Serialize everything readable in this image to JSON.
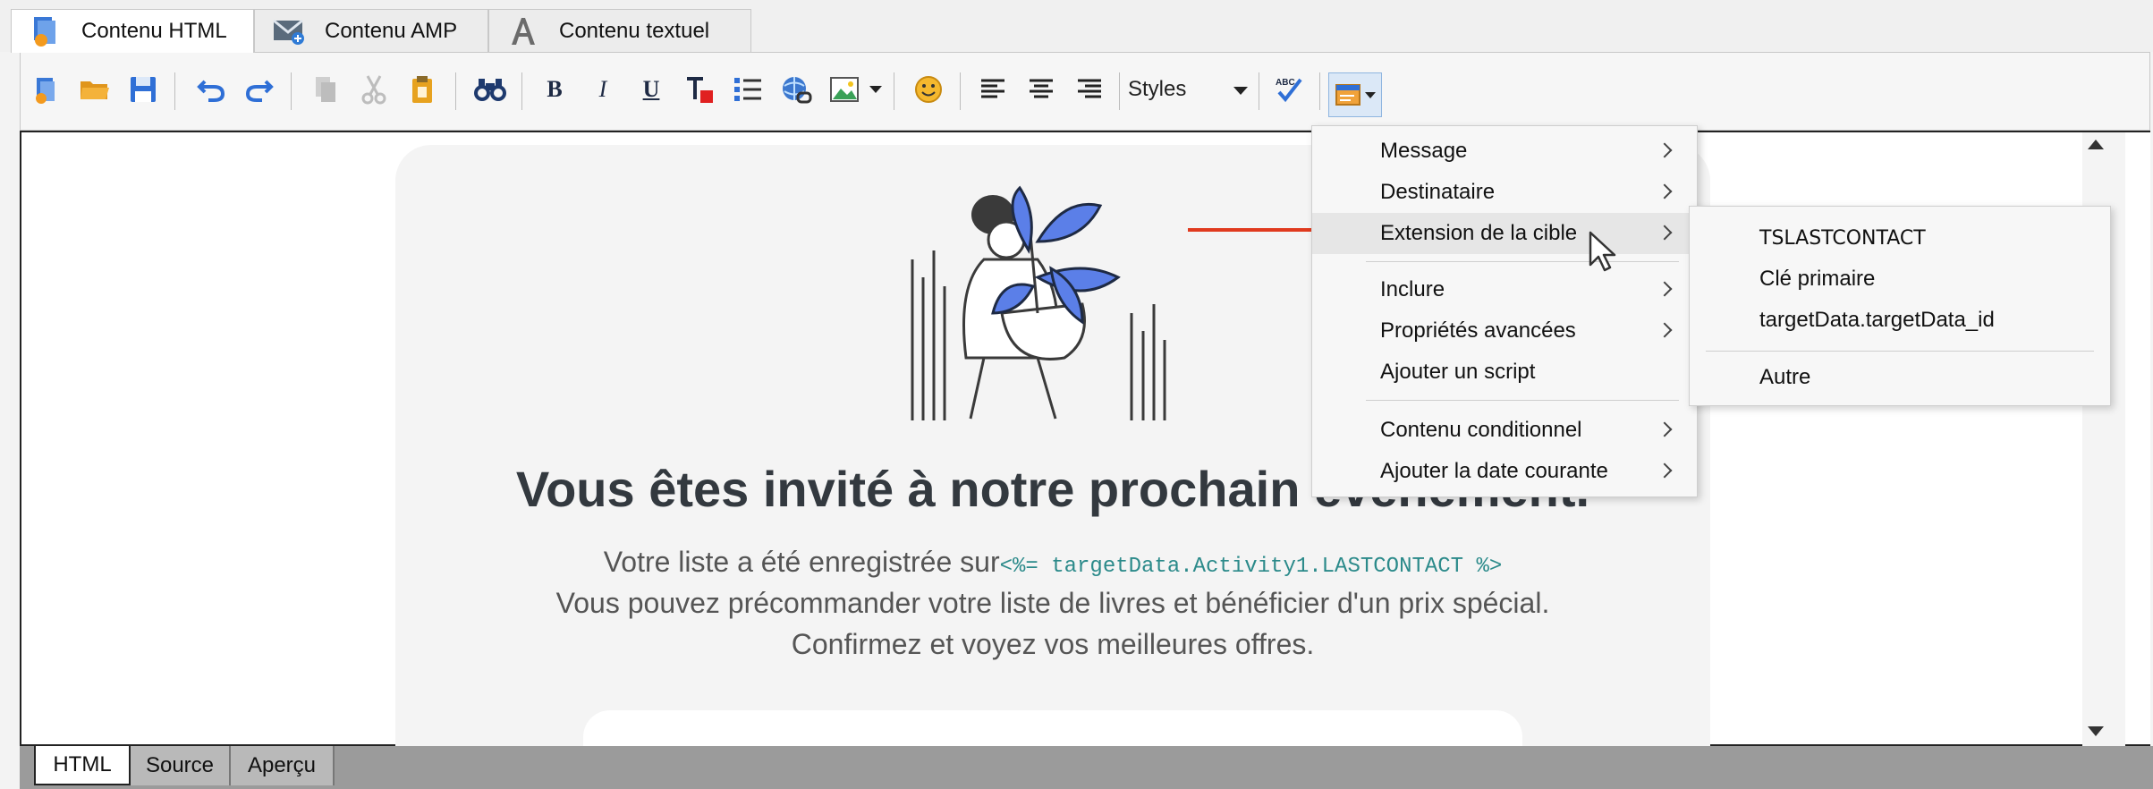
{
  "tabs": [
    {
      "label": "Contenu HTML",
      "icon": "html-content-icon",
      "active": true
    },
    {
      "label": "Contenu AMP",
      "icon": "amp-email-icon",
      "active": false
    },
    {
      "label": "Contenu textuel",
      "icon": "text-content-icon",
      "active": false
    }
  ],
  "toolbar": {
    "bold": "B",
    "italic": "I",
    "underline": "U",
    "styles_label": "Styles",
    "icons": [
      "new-icon",
      "open-folder-icon",
      "save-icon",
      "undo-icon",
      "redo-icon",
      "copy-icon",
      "cut-icon",
      "paste-icon",
      "find-icon",
      "bold-icon",
      "italic-icon",
      "underline-icon",
      "text-color-icon",
      "list-icon",
      "link-icon",
      "image-icon",
      "emoticon-icon",
      "align-left-icon",
      "align-center-icon",
      "align-right-icon",
      "spellcheck-icon",
      "personalization-icon"
    ]
  },
  "email": {
    "heading": "Vous êtes invité à notre prochain événement.",
    "line1_prefix": "Votre liste a été enregistrée sur",
    "line1_code": "<%= targetData.Activity1.LASTCONTACT %>",
    "line2": "Vous pouvez précommander votre liste de livres et bénéficier d'un prix spécial.",
    "line3": "Confirmez et voyez vos meilleures offres."
  },
  "context_menu": {
    "items": [
      {
        "label": "Message",
        "submenu": true
      },
      {
        "label": "Destinataire",
        "submenu": true
      },
      {
        "label": "Extension de la cible",
        "submenu": true,
        "highlighted": true
      },
      {
        "label": "Inclure",
        "submenu": true
      },
      {
        "label": "Propriétés avancées",
        "submenu": true
      },
      {
        "label": "Ajouter un script",
        "submenu": false
      },
      {
        "label": "Contenu conditionnel",
        "submenu": true
      },
      {
        "label": "Ajouter la date courante",
        "submenu": true
      }
    ]
  },
  "submenu": {
    "items": [
      "TSLASTCONTACT",
      "Clé primaire",
      "targetData.targetData_id",
      "Autre"
    ]
  },
  "bottom_tabs": [
    {
      "label": "HTML",
      "active": true
    },
    {
      "label": "Source",
      "active": false
    },
    {
      "label": "Aperçu",
      "active": false
    }
  ],
  "colors": {
    "accent": "#2f6fd6",
    "arrow": "#e03a1e",
    "leaf": "#5b7fe8"
  }
}
